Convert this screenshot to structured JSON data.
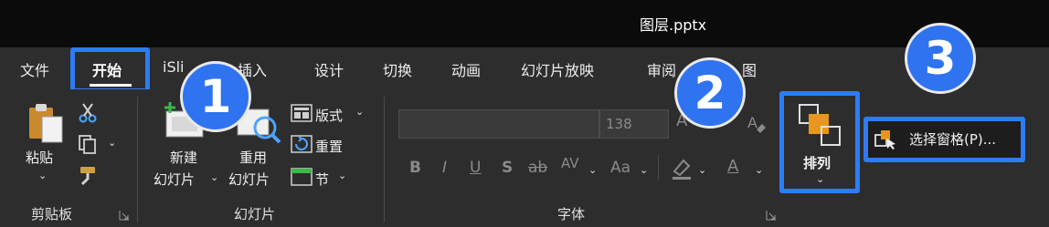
{
  "window": {
    "title": "图层.pptx"
  },
  "tabs": [
    {
      "label": "文件"
    },
    {
      "label": "开始"
    },
    {
      "label": "iSli"
    },
    {
      "label": "插入"
    },
    {
      "label": "设计"
    },
    {
      "label": "切换"
    },
    {
      "label": "动画"
    },
    {
      "label": "幻灯片放映"
    },
    {
      "label": "审阅"
    },
    {
      "label": "图"
    }
  ],
  "clipboard": {
    "paste_label": "粘贴",
    "group_label": "剪贴板"
  },
  "slides": {
    "new_slide_label_1": "新建",
    "new_slide_label_2": "幻灯片",
    "reuse_label_1": "重用",
    "reuse_label_2": "幻灯片",
    "layout_label": "版式",
    "reset_label": "重置",
    "section_label": "节",
    "group_label": "幻灯片"
  },
  "font": {
    "font_name": "",
    "font_size": "138",
    "group_label": "字体",
    "bold": "B",
    "italic": "I",
    "underline": "U",
    "shadow": "S",
    "strike": "ab",
    "spacing": "AV",
    "case": "Aa",
    "color_a": "A",
    "grow_a": "A"
  },
  "arrange": {
    "label": "排列",
    "selection_pane_label": "选择窗格(P)..."
  },
  "badges": [
    "1",
    "2",
    "3"
  ],
  "colors": {
    "highlight": "#2d7cf6",
    "badge_fill": "#2f73f0",
    "arrange_orange": "#e8961e"
  }
}
